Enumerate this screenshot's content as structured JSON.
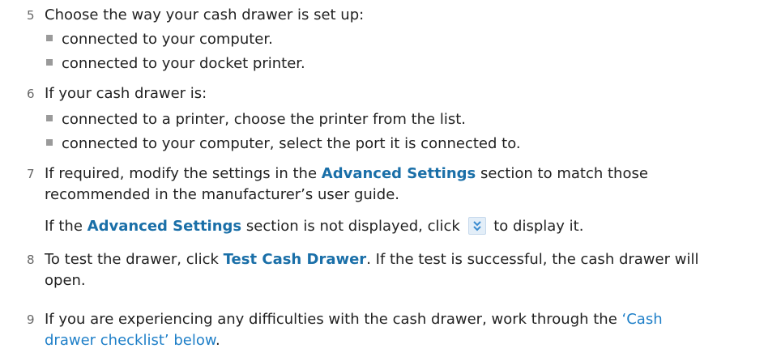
{
  "steps": [
    {
      "number": "5",
      "text": "Choose the way your cash drawer is set up:",
      "bullets": [
        "connected to your computer.",
        "connected to your docket printer."
      ]
    },
    {
      "number": "6",
      "text": "If your cash drawer is:",
      "bullets": [
        "connected to a printer, choose the printer from the list.",
        "connected to your computer, select the port it is connected to."
      ]
    },
    {
      "number": "7",
      "line1_pre": "If required, modify the settings in the ",
      "line1_ui": "Advanced Settings",
      "line1_post": " section to match those",
      "line2": "recommended in the manufacturer’s user guide.",
      "note_pre": "If the ",
      "note_ui": "Advanced Settings",
      "note_mid": " section is not displayed, click ",
      "note_icon": "chevron-double-down-icon",
      "note_post": " to display it."
    },
    {
      "number": "8",
      "line1_pre": "To test the drawer, click ",
      "line1_ui": "Test Cash Drawer",
      "line1_post": ". If the test is successful, the cash drawer will",
      "line2": "open."
    },
    {
      "number": "9",
      "line1_pre": "If you are experiencing any difficulties with the cash drawer, work through the ",
      "link_part1": "‘Cash",
      "link_part2": "drawer checklist’ below",
      "line2_post": "."
    }
  ],
  "colors": {
    "ui_text": "#1a6fa8",
    "link": "#1e7fc8",
    "bullet": "#9a9a9a",
    "step_number": "#666666"
  }
}
